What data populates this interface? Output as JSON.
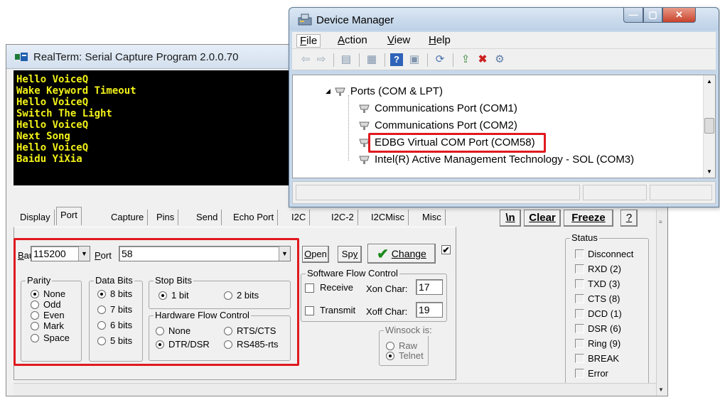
{
  "realterm": {
    "title": "RealTerm: Serial Capture Program 2.0.0.70",
    "terminal_lines": [
      "Hello VoiceQ",
      "Wake Keyword Timeout",
      "Hello VoiceQ",
      "Switch The Light",
      "Hello VoiceQ",
      "Next Song",
      "Hello VoiceQ",
      "Baidu YiXia"
    ],
    "tabs": [
      "Display",
      "Port",
      "Capture",
      "Pins",
      "Send",
      "Echo Port",
      "I2C",
      "I2C-2",
      "I2CMisc",
      "Misc"
    ],
    "active_tab": "Port",
    "toolbar": {
      "newline": "\\n",
      "clear": "Clear",
      "freeze": "Freeze",
      "help": "?"
    },
    "port": {
      "baud_label": "Baud",
      "baud_value": "115200",
      "port_label": "Port",
      "port_value": "58",
      "open": "Open",
      "spy": "Spy",
      "change": "Change",
      "parity": {
        "title": "Parity",
        "options": [
          "None",
          "Odd",
          "Even",
          "Mark",
          "Space"
        ],
        "selected": "None"
      },
      "data_bits": {
        "title": "Data Bits",
        "options": [
          "8 bits",
          "7 bits",
          "6 bits",
          "5 bits"
        ],
        "selected": "8 bits"
      },
      "stop_bits": {
        "title": "Stop Bits",
        "options": [
          "1 bit",
          "2 bits"
        ],
        "selected": "1 bit"
      },
      "hw_flow": {
        "title": "Hardware Flow Control",
        "options": [
          "None",
          "RTS/CTS",
          "DTR/DSR",
          "RS485-rts"
        ],
        "selected": "DTR/DSR"
      },
      "sw_flow": {
        "title": "Software Flow Control",
        "receive": "Receive",
        "transmit": "Transmit",
        "xon_label": "Xon Char:",
        "xon_value": "17",
        "xoff_label": "Xoff Char:",
        "xoff_value": "19"
      },
      "winsock": {
        "title": "Winsock is:",
        "options": [
          "Raw",
          "Telnet"
        ],
        "selected": "Telnet"
      }
    },
    "status": {
      "title": "Status",
      "items": [
        "Disconnect",
        "RXD (2)",
        "TXD (3)",
        "CTS (8)",
        "DCD (1)",
        "DSR (6)",
        "Ring (9)",
        "BREAK",
        "Error"
      ]
    }
  },
  "device_manager": {
    "title": "Device Manager",
    "menus": [
      "File",
      "Action",
      "View",
      "Help"
    ],
    "tree": {
      "category": "Ports (COM & LPT)",
      "items": [
        "Communications Port (COM1)",
        "Communications Port (COM2)",
        "EDBG Virtual COM Port (COM58)",
        "Intel(R) Active Management Technology - SOL (COM3)"
      ],
      "highlighted": "EDBG Virtual COM Port (COM58)"
    }
  },
  "colors": {
    "highlight": "#e0191f",
    "terminal_text": "#f2f218",
    "terminal_bg": "#000000"
  }
}
